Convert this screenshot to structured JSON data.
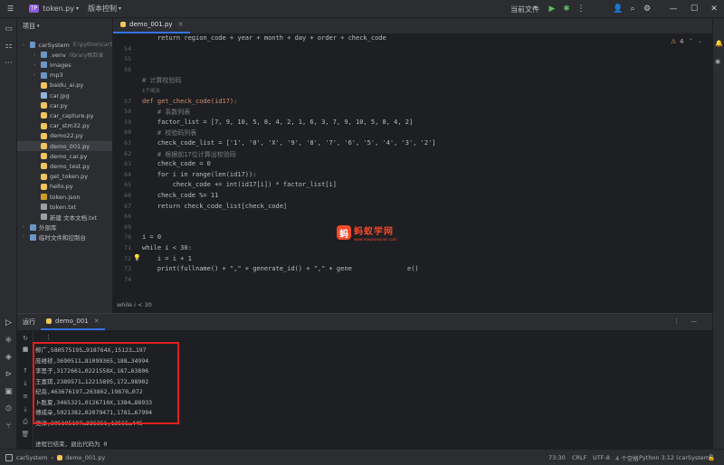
{
  "titlebar": {
    "project_badge": "TP",
    "project_name": "token.py",
    "vcs": "版本控制",
    "run_config": "当前文件"
  },
  "project_panel": {
    "header": "项目",
    "items": [
      {
        "label": "carSystem",
        "suffix": "E:\\python\\carS",
        "type": "folder",
        "indent": 0
      },
      {
        "label": ".venv",
        "suffix": "library根目录",
        "type": "folder",
        "indent": 1
      },
      {
        "label": "images",
        "type": "folder",
        "indent": 1
      },
      {
        "label": "mp3",
        "type": "folder",
        "indent": 1
      },
      {
        "label": "baidu_ai.py",
        "type": "py",
        "indent": 1
      },
      {
        "label": "car.jpg",
        "type": "img",
        "indent": 1
      },
      {
        "label": "car.py",
        "type": "py",
        "indent": 1
      },
      {
        "label": "car_capture.py",
        "type": "py",
        "indent": 1
      },
      {
        "label": "car_stm32.py",
        "type": "py",
        "indent": 1
      },
      {
        "label": "demo22.py",
        "type": "py",
        "indent": 1
      },
      {
        "label": "demo_001.py",
        "type": "py",
        "indent": 1,
        "selected": true
      },
      {
        "label": "demo_car.py",
        "type": "py",
        "indent": 1
      },
      {
        "label": "demo_test.py",
        "type": "py",
        "indent": 1
      },
      {
        "label": "get_token.py",
        "type": "py",
        "indent": 1
      },
      {
        "label": "hello.py",
        "type": "py",
        "indent": 1
      },
      {
        "label": "token.json",
        "type": "json",
        "indent": 1
      },
      {
        "label": "token.txt",
        "type": "txt",
        "indent": 1
      },
      {
        "label": "新建 文本文档.txt",
        "type": "txt",
        "indent": 1
      },
      {
        "label": "外部库",
        "type": "folder",
        "indent": 0
      },
      {
        "label": "临时文件和控制台",
        "type": "folder",
        "indent": 0
      }
    ]
  },
  "editor": {
    "tab": "demo_001.py",
    "warnings": "4",
    "breadcrumb": "while i < 30",
    "lines": [
      {
        "num": "",
        "html": "    return region_code + year + month + day + order + check_code"
      },
      {
        "num": "54",
        "html": ""
      },
      {
        "num": "55",
        "html": ""
      },
      {
        "num": "56",
        "html": ""
      },
      {
        "num": "",
        "html": "# 计算校验码"
      },
      {
        "num": "",
        "html": "1个用法"
      },
      {
        "num": "57",
        "html": "def get_check_code(id17):"
      },
      {
        "num": "58",
        "html": "    # 系数列表"
      },
      {
        "num": "59",
        "html": "    factor_list = [7, 9, 10, 5, 8, 4, 2, 1, 6, 3, 7, 9, 10, 5, 8, 4, 2]"
      },
      {
        "num": "60",
        "html": "    # 校验码列表"
      },
      {
        "num": "61",
        "html": "    check_code_list = ['1', '0', 'X', '9', '8', '7', '6', '5', '4', '3', '2']"
      },
      {
        "num": "62",
        "html": "    # 根据前17位计算出校验码"
      },
      {
        "num": "63",
        "html": "    check_code = 0"
      },
      {
        "num": "64",
        "html": "    for i in range(len(id17)):"
      },
      {
        "num": "65",
        "html": "        check_code += int(id17[i]) * factor_list[i]"
      },
      {
        "num": "66",
        "html": "    check_code %= 11"
      },
      {
        "num": "67",
        "html": "    return check_code_list[check_code]"
      },
      {
        "num": "68",
        "html": ""
      },
      {
        "num": "69",
        "html": ""
      },
      {
        "num": "70",
        "html": "i = 0"
      },
      {
        "num": "71",
        "html": "while i < 30:"
      },
      {
        "num": "72",
        "html": "    i = i + 1"
      },
      {
        "num": "73",
        "html": "    print(fullname() + \",\" + generate_id() + \",\" + gene"
      },
      {
        "num": "74",
        "html": ""
      }
    ],
    "line73_tail": "e()"
  },
  "watermark": {
    "logo": "蚂",
    "title": "蚂蚁学网",
    "url": "www.mayixueyuan.com"
  },
  "run_panel": {
    "tab_label": "运行",
    "tab_name": "demo_001",
    "output": [
      "柳广,580575195…918764X,15123…197",
      "庞维祯,3690511…81099365,188…34994",
      "李思子,3172661…0221558X,187…63806",
      "王富琪,2389571…12215895,172…98902",
      "纪岳,463676197…263862,19870…072",
      "卜胜夏,3465321…0126710X,1384…88933",
      "傅成朵,5021382…02079471,1781…67994",
      "党洋,395195197…226351,13565…445"
    ],
    "finish": "进程已结束，退出代码为 0"
  },
  "statusbar": {
    "project": "carSystem",
    "file": "demo_001.py",
    "position": "73:30",
    "line_sep": "CRLF",
    "encoding": "UTF-8",
    "indent": "4 个空格",
    "interpreter": "Python 3.12 (carSystem)"
  }
}
